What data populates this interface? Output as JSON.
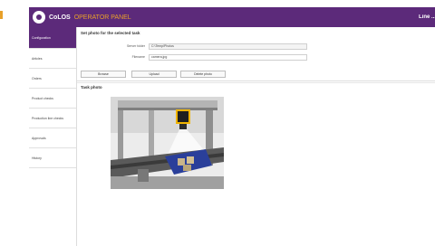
{
  "header": {
    "brand_name": "CoLOS",
    "brand_subtitle": "OPERATOR PANEL",
    "right_label": "Line ..."
  },
  "sidebar": {
    "items": [
      {
        "label": "Configuration",
        "active": true
      },
      {
        "label": "Articles",
        "active": false
      },
      {
        "label": "Orders",
        "active": false
      },
      {
        "label": "Product checks",
        "active": false
      },
      {
        "label": "Production line checks",
        "active": false
      },
      {
        "label": "Approvals",
        "active": false
      },
      {
        "label": "History",
        "active": false
      }
    ]
  },
  "main": {
    "section_title": "Set photo for the selected task",
    "fields": {
      "server_folder_label": "Server folder",
      "server_folder_value": "C:\\Temp\\Photos",
      "filename_label": "Filename",
      "filename_value": "camera.jpg"
    },
    "buttons": {
      "browse": "Browse",
      "upload": "Upload",
      "delete_photo": "Delete photo"
    },
    "photo_title": "Task photo"
  },
  "colors": {
    "accent": "#5c2a7a",
    "brand_highlight": "#e8a02a"
  }
}
